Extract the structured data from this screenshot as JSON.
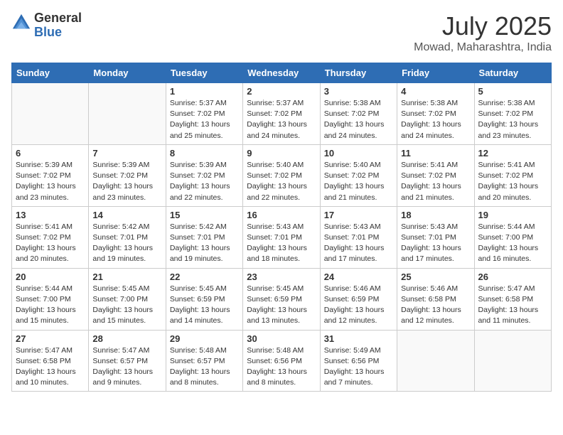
{
  "header": {
    "logo_line1": "General",
    "logo_line2": "Blue",
    "month": "July 2025",
    "location": "Mowad, Maharashtra, India"
  },
  "weekdays": [
    "Sunday",
    "Monday",
    "Tuesday",
    "Wednesday",
    "Thursday",
    "Friday",
    "Saturday"
  ],
  "weeks": [
    [
      {
        "day": "",
        "info": ""
      },
      {
        "day": "",
        "info": ""
      },
      {
        "day": "1",
        "info": "Sunrise: 5:37 AM\nSunset: 7:02 PM\nDaylight: 13 hours\nand 25 minutes."
      },
      {
        "day": "2",
        "info": "Sunrise: 5:37 AM\nSunset: 7:02 PM\nDaylight: 13 hours\nand 24 minutes."
      },
      {
        "day": "3",
        "info": "Sunrise: 5:38 AM\nSunset: 7:02 PM\nDaylight: 13 hours\nand 24 minutes."
      },
      {
        "day": "4",
        "info": "Sunrise: 5:38 AM\nSunset: 7:02 PM\nDaylight: 13 hours\nand 24 minutes."
      },
      {
        "day": "5",
        "info": "Sunrise: 5:38 AM\nSunset: 7:02 PM\nDaylight: 13 hours\nand 23 minutes."
      }
    ],
    [
      {
        "day": "6",
        "info": "Sunrise: 5:39 AM\nSunset: 7:02 PM\nDaylight: 13 hours\nand 23 minutes."
      },
      {
        "day": "7",
        "info": "Sunrise: 5:39 AM\nSunset: 7:02 PM\nDaylight: 13 hours\nand 23 minutes."
      },
      {
        "day": "8",
        "info": "Sunrise: 5:39 AM\nSunset: 7:02 PM\nDaylight: 13 hours\nand 22 minutes."
      },
      {
        "day": "9",
        "info": "Sunrise: 5:40 AM\nSunset: 7:02 PM\nDaylight: 13 hours\nand 22 minutes."
      },
      {
        "day": "10",
        "info": "Sunrise: 5:40 AM\nSunset: 7:02 PM\nDaylight: 13 hours\nand 21 minutes."
      },
      {
        "day": "11",
        "info": "Sunrise: 5:41 AM\nSunset: 7:02 PM\nDaylight: 13 hours\nand 21 minutes."
      },
      {
        "day": "12",
        "info": "Sunrise: 5:41 AM\nSunset: 7:02 PM\nDaylight: 13 hours\nand 20 minutes."
      }
    ],
    [
      {
        "day": "13",
        "info": "Sunrise: 5:41 AM\nSunset: 7:02 PM\nDaylight: 13 hours\nand 20 minutes."
      },
      {
        "day": "14",
        "info": "Sunrise: 5:42 AM\nSunset: 7:01 PM\nDaylight: 13 hours\nand 19 minutes."
      },
      {
        "day": "15",
        "info": "Sunrise: 5:42 AM\nSunset: 7:01 PM\nDaylight: 13 hours\nand 19 minutes."
      },
      {
        "day": "16",
        "info": "Sunrise: 5:43 AM\nSunset: 7:01 PM\nDaylight: 13 hours\nand 18 minutes."
      },
      {
        "day": "17",
        "info": "Sunrise: 5:43 AM\nSunset: 7:01 PM\nDaylight: 13 hours\nand 17 minutes."
      },
      {
        "day": "18",
        "info": "Sunrise: 5:43 AM\nSunset: 7:01 PM\nDaylight: 13 hours\nand 17 minutes."
      },
      {
        "day": "19",
        "info": "Sunrise: 5:44 AM\nSunset: 7:00 PM\nDaylight: 13 hours\nand 16 minutes."
      }
    ],
    [
      {
        "day": "20",
        "info": "Sunrise: 5:44 AM\nSunset: 7:00 PM\nDaylight: 13 hours\nand 15 minutes."
      },
      {
        "day": "21",
        "info": "Sunrise: 5:45 AM\nSunset: 7:00 PM\nDaylight: 13 hours\nand 15 minutes."
      },
      {
        "day": "22",
        "info": "Sunrise: 5:45 AM\nSunset: 6:59 PM\nDaylight: 13 hours\nand 14 minutes."
      },
      {
        "day": "23",
        "info": "Sunrise: 5:45 AM\nSunset: 6:59 PM\nDaylight: 13 hours\nand 13 minutes."
      },
      {
        "day": "24",
        "info": "Sunrise: 5:46 AM\nSunset: 6:59 PM\nDaylight: 13 hours\nand 12 minutes."
      },
      {
        "day": "25",
        "info": "Sunrise: 5:46 AM\nSunset: 6:58 PM\nDaylight: 13 hours\nand 12 minutes."
      },
      {
        "day": "26",
        "info": "Sunrise: 5:47 AM\nSunset: 6:58 PM\nDaylight: 13 hours\nand 11 minutes."
      }
    ],
    [
      {
        "day": "27",
        "info": "Sunrise: 5:47 AM\nSunset: 6:58 PM\nDaylight: 13 hours\nand 10 minutes."
      },
      {
        "day": "28",
        "info": "Sunrise: 5:47 AM\nSunset: 6:57 PM\nDaylight: 13 hours\nand 9 minutes."
      },
      {
        "day": "29",
        "info": "Sunrise: 5:48 AM\nSunset: 6:57 PM\nDaylight: 13 hours\nand 8 minutes."
      },
      {
        "day": "30",
        "info": "Sunrise: 5:48 AM\nSunset: 6:56 PM\nDaylight: 13 hours\nand 8 minutes."
      },
      {
        "day": "31",
        "info": "Sunrise: 5:49 AM\nSunset: 6:56 PM\nDaylight: 13 hours\nand 7 minutes."
      },
      {
        "day": "",
        "info": ""
      },
      {
        "day": "",
        "info": ""
      }
    ]
  ]
}
